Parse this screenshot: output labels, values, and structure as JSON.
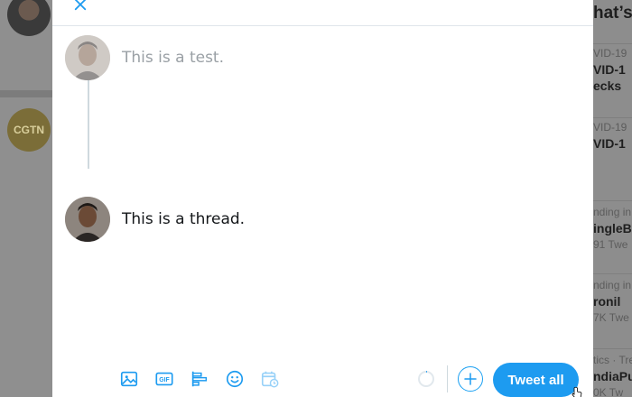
{
  "background": {
    "left_badge_text": "CGTN",
    "right_heading": "hat’s",
    "trends": [
      {
        "meta": "VID-19",
        "name": "VID-1",
        "name2": "ecks"
      },
      {
        "meta": "VID-19",
        "name": "VID-1"
      },
      {
        "meta": "nding in",
        "name": "ingleB",
        "count": "91 Twe"
      },
      {
        "meta": "nding in",
        "name": "ronil",
        "count": "7K Twe"
      },
      {
        "meta": "tics · Tre",
        "name": "ndiaPu",
        "count": "0K Tw"
      }
    ]
  },
  "modal": {
    "close_icon": "close-icon",
    "tweets": [
      {
        "text": "This is a test.",
        "state": "placeholder"
      },
      {
        "text": "This is a thread.",
        "state": "filled"
      }
    ],
    "toolbar": {
      "icons": [
        "image-icon",
        "gif-icon",
        "poll-icon",
        "emoji-icon",
        "schedule-icon"
      ],
      "gif_label": "GIF",
      "tweet_all_label": "Tweet all"
    }
  },
  "colors": {
    "accent": "#1d9bf0",
    "overlay": "#8e8e8e"
  }
}
